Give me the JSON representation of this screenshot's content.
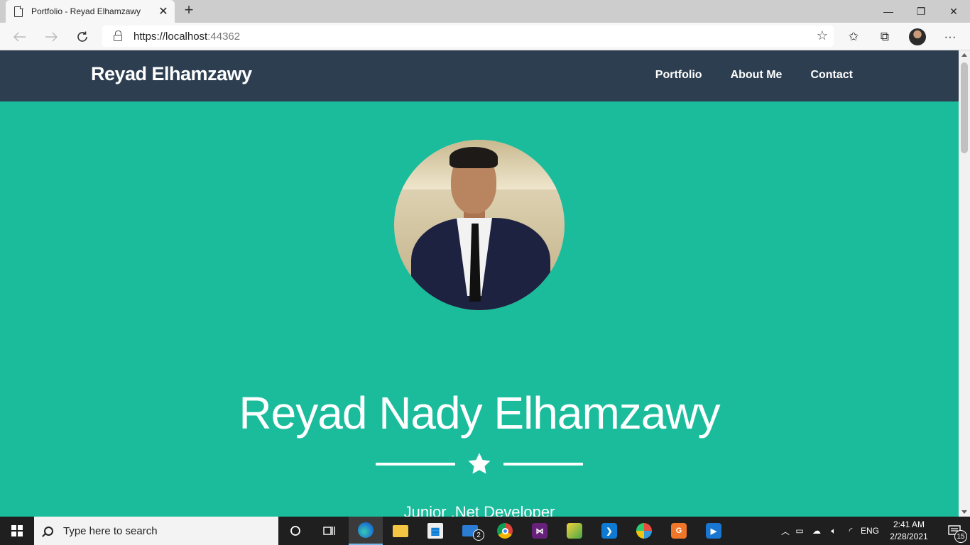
{
  "browser": {
    "tab_title": "Portfolio - Reyad Elhamzawy",
    "tab_close": "✕",
    "new_tab": "+",
    "url_scheme_host": "https://localhost",
    "url_port": ":44362",
    "window_controls": {
      "minimize": "—",
      "restore": "❐",
      "close": "✕"
    }
  },
  "site": {
    "brand": "Reyad Elhamzawy",
    "nav": [
      "Portfolio",
      "About Me",
      "Contact"
    ],
    "hero_name": "Reyad Nady Elhamzawy",
    "subtitle": "Junior .Net Developer",
    "colors": {
      "navbar": "#2c3e50",
      "hero": "#1abc9c",
      "text": "#ffffff"
    }
  },
  "taskbar": {
    "search_placeholder": "Type here to search",
    "mail_badge": "2",
    "language": "ENG",
    "time": "2:41 AM",
    "date": "2/28/2021",
    "notification_count": "15"
  }
}
